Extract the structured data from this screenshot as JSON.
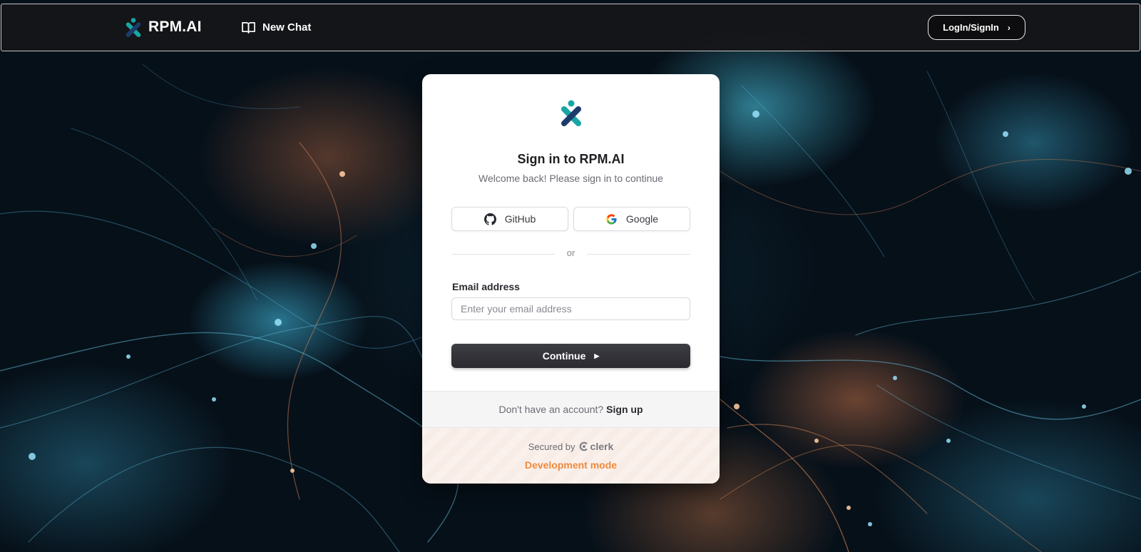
{
  "header": {
    "brand_name": "RPM.AI",
    "new_chat_label": "New Chat",
    "login_label": "LogIn/SignIn",
    "login_chevron": "›"
  },
  "card": {
    "title": "Sign in to RPM.AI",
    "subtitle": "Welcome back! Please sign in to continue",
    "social": {
      "github_label": "GitHub",
      "google_label": "Google"
    },
    "divider_text": "or",
    "email": {
      "label": "Email address",
      "placeholder": "Enter your email address",
      "value": ""
    },
    "continue_label": "Continue",
    "continue_arrow": "▶",
    "signup_prompt": "Don't have an account?",
    "signup_link": "Sign up",
    "secured_by": "Secured by",
    "clerk_name": "clerk",
    "dev_mode": "Development mode"
  },
  "colors": {
    "brand_teal": "#1aa5a5",
    "brand_navy": "#1d3b6b",
    "dev_mode_orange": "#ef8a3c",
    "button_dark": "#2f2f35"
  },
  "icons": {
    "brand": "rpm-ai-logo-icon",
    "new_chat": "book-open-icon",
    "github": "github-icon",
    "google": "google-icon",
    "clerk": "clerk-logo-icon"
  }
}
